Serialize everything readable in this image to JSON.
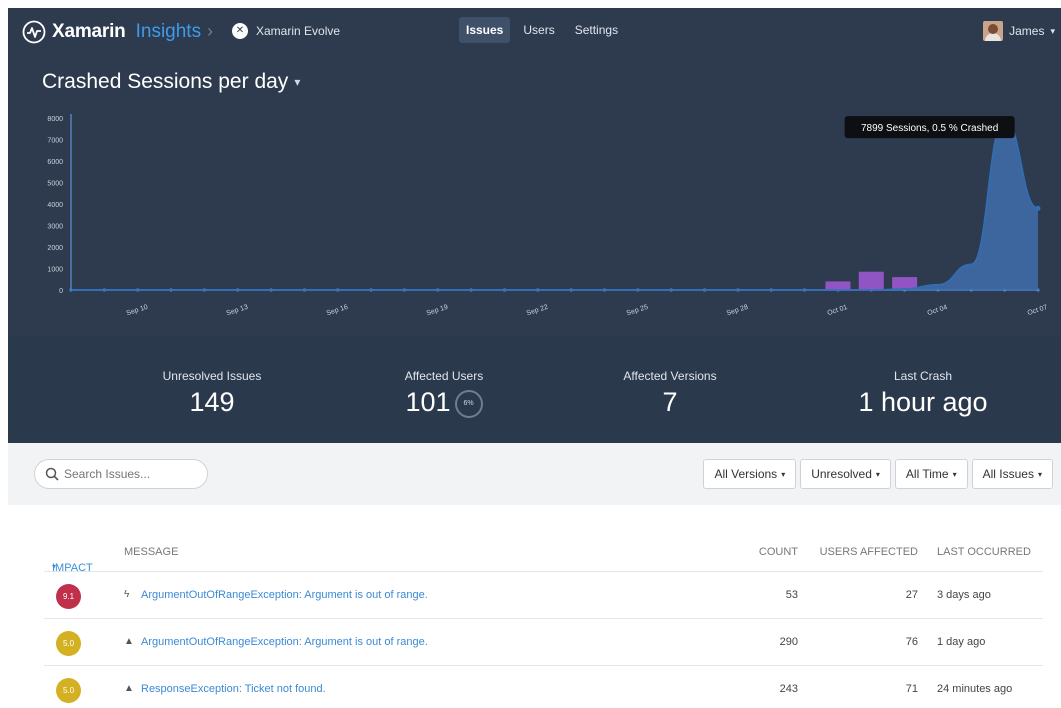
{
  "header": {
    "brand_bold": "Xamarin",
    "brand_light": "Insights",
    "app_name": "Xamarin Evolve",
    "tabs": [
      {
        "label": "Issues",
        "active": true
      },
      {
        "label": "Users",
        "active": false
      },
      {
        "label": "Settings",
        "active": false
      }
    ],
    "user_name": "James"
  },
  "chart_title": "Crashed Sessions per day",
  "chart_data": {
    "type": "area",
    "title": "Crashed Sessions per day",
    "yticks": [
      0,
      1000,
      2000,
      3000,
      4000,
      5000,
      6000,
      7000,
      8000
    ],
    "ylim": [
      0,
      8000
    ],
    "xtick_labels": [
      "Sep 10",
      "Sep 13",
      "Sep 16",
      "Sep 19",
      "Sep 22",
      "Sep 25",
      "Sep 28",
      "Oct 01",
      "Oct 04",
      "Oct 07"
    ],
    "x": [
      "Sep 08",
      "Sep 09",
      "Sep 10",
      "Sep 11",
      "Sep 12",
      "Sep 13",
      "Sep 14",
      "Sep 15",
      "Sep 16",
      "Sep 17",
      "Sep 18",
      "Sep 19",
      "Sep 20",
      "Sep 21",
      "Sep 22",
      "Sep 23",
      "Sep 24",
      "Sep 25",
      "Sep 26",
      "Sep 27",
      "Sep 28",
      "Sep 29",
      "Sep 30",
      "Oct 01",
      "Oct 02",
      "Oct 03",
      "Oct 04",
      "Oct 05",
      "Oct 06",
      "Oct 07"
    ],
    "series": [
      {
        "kind": "area",
        "color": "#3f6fae",
        "values": [
          0,
          0,
          0,
          0,
          0,
          0,
          0,
          0,
          0,
          0,
          0,
          0,
          0,
          0,
          0,
          0,
          0,
          0,
          0,
          0,
          0,
          0,
          0,
          0,
          0,
          50,
          250,
          1200,
          7899,
          3800
        ]
      },
      {
        "kind": "bar",
        "color": "#9b59d0",
        "values": [
          0,
          0,
          0,
          0,
          0,
          0,
          0,
          0,
          0,
          0,
          0,
          0,
          0,
          0,
          0,
          0,
          0,
          0,
          0,
          0,
          0,
          0,
          0,
          400,
          850,
          600,
          0,
          0,
          0,
          0
        ]
      }
    ],
    "tooltip": "7899 Sessions, 0.5 % Crashed",
    "grid": false
  },
  "stats": [
    {
      "label": "Unresolved Issues",
      "value": "149"
    },
    {
      "label": "Affected Users",
      "value": "101",
      "percent": "6%"
    },
    {
      "label": "Affected Versions",
      "value": "7"
    },
    {
      "label": "Last Crash",
      "value": "1 hour ago"
    }
  ],
  "search": {
    "placeholder": "Search Issues..."
  },
  "filters": [
    "All Versions",
    "Unresolved",
    "All Time",
    "All Issues"
  ],
  "table": {
    "columns": {
      "impact": "IMPACT",
      "message": "MESSAGE",
      "count": "COUNT",
      "users": "USERS AFFECTED",
      "last": "LAST OCCURRED"
    },
    "rows": [
      {
        "impact": "9.1",
        "color": "#c0304a",
        "icon": "lightning-icon",
        "message": "ArgumentOutOfRangeException: Argument is out of range.",
        "count": "53",
        "users": "27",
        "last": "3 days ago"
      },
      {
        "impact": "5.0",
        "color": "#d4b122",
        "icon": "warning-icon",
        "message": "ArgumentOutOfRangeException: Argument is out of range.",
        "count": "290",
        "users": "76",
        "last": "1 day ago"
      },
      {
        "impact": "5.0",
        "color": "#d4b122",
        "icon": "warning-icon",
        "message": "ResponseException: Ticket not found.",
        "count": "243",
        "users": "71",
        "last": "24 minutes ago"
      }
    ]
  }
}
